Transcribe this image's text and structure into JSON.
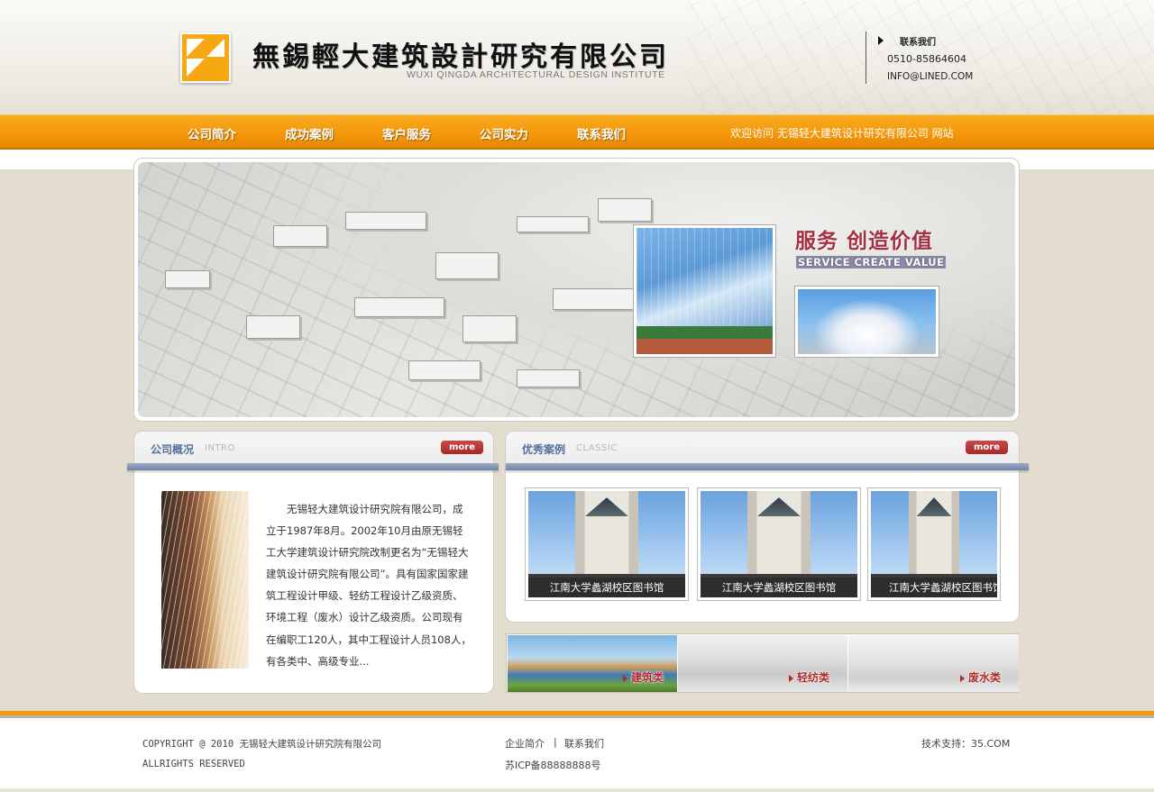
{
  "header": {
    "company_name": "無錫輕大建筑設計研究有限公司",
    "company_name_en": "WUXI QINGDA ARCHITECTURAL DESIGN INSTITUTE",
    "contact_title": "联系我们",
    "phone": "0510-85864604",
    "email": "INFO@LINED.COM"
  },
  "nav": {
    "items": [
      {
        "label": "公司简介"
      },
      {
        "label": "成功案例"
      },
      {
        "label": "客户服务"
      },
      {
        "label": "公司实力"
      },
      {
        "label": "联系我们"
      }
    ],
    "welcome": "欢迎访问  无锡轻大建筑设计研究有限公司  网站"
  },
  "banner": {
    "slogan_cn": "服务 创造价值",
    "slogan_en": "SERVICE CREATE VALUE"
  },
  "intro": {
    "title": "公司概况",
    "subtitle": "INTRO",
    "more": "more",
    "text": "无锡轻大建筑设计研究院有限公司，成立于1987年8月。2002年10月由原无锡轻工大学建筑设计研究院改制更名为“无锡轻大建筑设计研究院有限公司”。具有国家国家建筑工程设计甲级、轻纺工程设计乙级资质、环境工程（废水）设计乙级资质。公司现有在编职工120人，其中工程设计人员108人，有各类中、高级专业..."
  },
  "classic": {
    "title": "优秀案例",
    "subtitle": "CLASSIC",
    "more": "more",
    "cases": [
      {
        "label": "江南大学蠡湖校区图书馆"
      },
      {
        "label": "江南大学蠡湖校区图书馆"
      },
      {
        "label": "江南大学蠡湖校区图书馆"
      }
    ]
  },
  "categories": [
    {
      "label": "建筑类"
    },
    {
      "label": "轻纺类"
    },
    {
      "label": "废水类"
    }
  ],
  "footer": {
    "copyright": "COPYRIGHT @ 2010 无锡轻大建筑设计研究院有限公司",
    "rights": "ALLRIGHTS RESERVED",
    "link_about": "企业简介",
    "separator": "|",
    "link_contact": "联系我们",
    "icp": "苏ICP备88888888号",
    "support": "技术支持：35.COM"
  },
  "colors": {
    "nav_orange": "#f3960a",
    "accent_red": "#a53040",
    "panel_title_blue": "#576e9a"
  }
}
